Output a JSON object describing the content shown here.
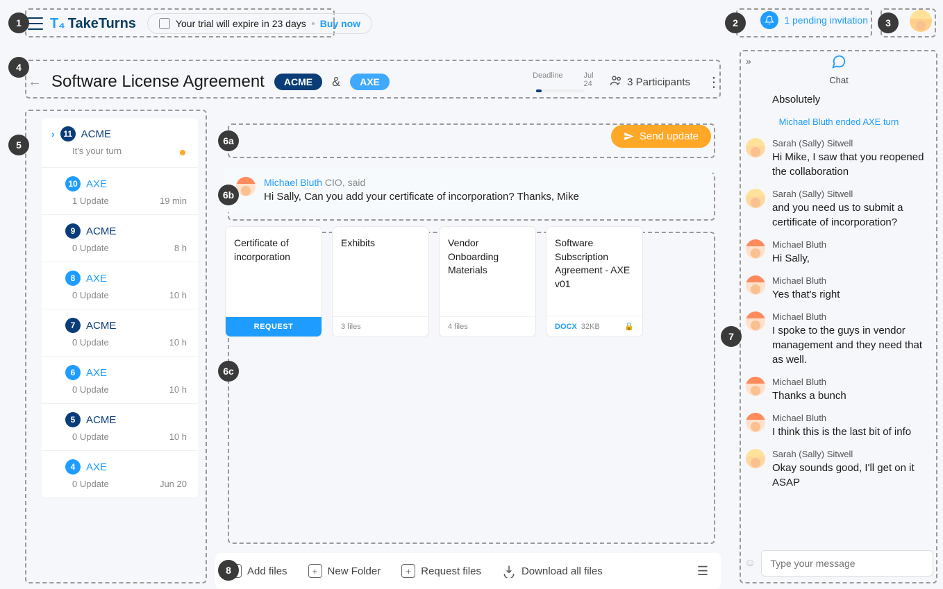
{
  "header": {
    "logo_text": "TakeTurns",
    "trial_text": "Your trial will expire in 23 days",
    "buy_text": "Buy now",
    "notif_text": "1 pending invitation"
  },
  "titlebar": {
    "title": "Software License Agreement",
    "party_a": "ACME",
    "amp": "&",
    "party_b": "AXE",
    "deadline_label": "Deadline",
    "deadline_date": "Jul 24",
    "participants": "3 Participants"
  },
  "sidebar": [
    {
      "num": "11",
      "party": "ACME",
      "dark": true,
      "sub": "It's your turn",
      "time": "",
      "current": true
    },
    {
      "num": "10",
      "party": "AXE",
      "dark": false,
      "sub": "1 Update",
      "time": "19 min"
    },
    {
      "num": "9",
      "party": "ACME",
      "dark": true,
      "sub": "0 Update",
      "time": "8 h"
    },
    {
      "num": "8",
      "party": "AXE",
      "dark": false,
      "sub": "0 Update",
      "time": "10 h"
    },
    {
      "num": "7",
      "party": "ACME",
      "dark": true,
      "sub": "0 Update",
      "time": "10 h"
    },
    {
      "num": "6",
      "party": "AXE",
      "dark": false,
      "sub": "0 Update",
      "time": "10 h"
    },
    {
      "num": "5",
      "party": "ACME",
      "dark": true,
      "sub": "0 Update",
      "time": "10 h"
    },
    {
      "num": "4",
      "party": "AXE",
      "dark": false,
      "sub": "0 Update",
      "time": "Jun 20"
    }
  ],
  "main": {
    "send_label": "Send update",
    "msg_author": "Michael Bluth",
    "msg_role": " CIO, said",
    "msg_body": "Hi Sally, Can you add your certificate of incorporation? Thanks, Mike"
  },
  "files": [
    {
      "title": "Certificate of incorporation",
      "footer_type": "request",
      "footer_text": "REQUEST"
    },
    {
      "title": "Exhibits",
      "footer_type": "folder",
      "footer_text": "3 files"
    },
    {
      "title": "Vendor Onboarding Materials",
      "footer_type": "folder",
      "footer_text": "4 files"
    },
    {
      "title": "Software Subscription Agreement - AXE v01",
      "footer_type": "doc",
      "docx": "DOCX",
      "size": "32KB",
      "locked": true
    }
  ],
  "bottombar": {
    "add_files": "Add files",
    "new_folder": "New Folder",
    "request_files": "Request files",
    "download_all": "Download all files"
  },
  "chat": {
    "label": "Chat",
    "orphan_body": "Absolutely",
    "system": "Michael Bluth ended AXE turn",
    "messages": [
      {
        "author": "Sarah (Sally) Sitwell",
        "body": "Hi Mike, I saw that you reopened the collaboration",
        "who": "sally"
      },
      {
        "author": "Sarah (Sally) Sitwell",
        "body": "and you need us to submit a certificate of incorporation?",
        "who": "sally"
      },
      {
        "author": "Michael Bluth",
        "body": "Hi Sally,",
        "who": "mike"
      },
      {
        "author": "Michael Bluth",
        "body": "Yes that's right",
        "who": "mike"
      },
      {
        "author": "Michael Bluth",
        "body": "I spoke to the guys in vendor management and they need that as well.",
        "who": "mike"
      },
      {
        "author": "Michael Bluth",
        "body": "Thanks a bunch",
        "who": "mike"
      },
      {
        "author": "Michael Bluth",
        "body": "I think this is the last bit of info",
        "who": "mike"
      },
      {
        "author": "Sarah (Sally) Sitwell",
        "body": "Okay sounds good, I'll get on it ASAP",
        "who": "sally"
      }
    ],
    "placeholder": "Type your message"
  },
  "markers": {
    "m1": "1",
    "m2": "2",
    "m3": "3",
    "m4": "4",
    "m5": "5",
    "m6a": "6a",
    "m6b": "6b",
    "m6c": "6c",
    "m7": "7",
    "m8": "8"
  }
}
